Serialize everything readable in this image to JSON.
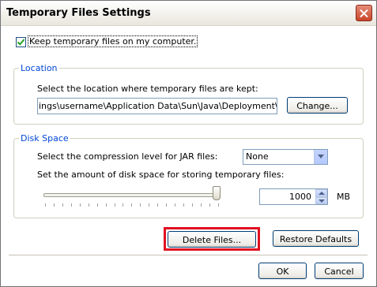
{
  "window": {
    "title": "Temporary Files Settings"
  },
  "keep_files": {
    "label": "Keep temporary files on my computer.",
    "checked": true
  },
  "location": {
    "legend": "Location",
    "description": "Select the location where temporary files are kept:",
    "path": "ings\\username\\Application Data\\Sun\\Java\\Deployment\\cache",
    "change_label": "Change..."
  },
  "disk_space": {
    "legend": "Disk Space",
    "compression_label": "Select the compression level for JAR files:",
    "compression_value": "None",
    "amount_label": "Set the amount of disk space for storing temporary files:",
    "amount_value": "1000",
    "unit": "MB"
  },
  "actions": {
    "delete_label": "Delete Files...",
    "restore_label": "Restore Defaults"
  },
  "footer": {
    "ok_label": "OK",
    "cancel_label": "Cancel"
  },
  "colors": {
    "highlight": "#e01020",
    "legend": "#0046d5"
  }
}
